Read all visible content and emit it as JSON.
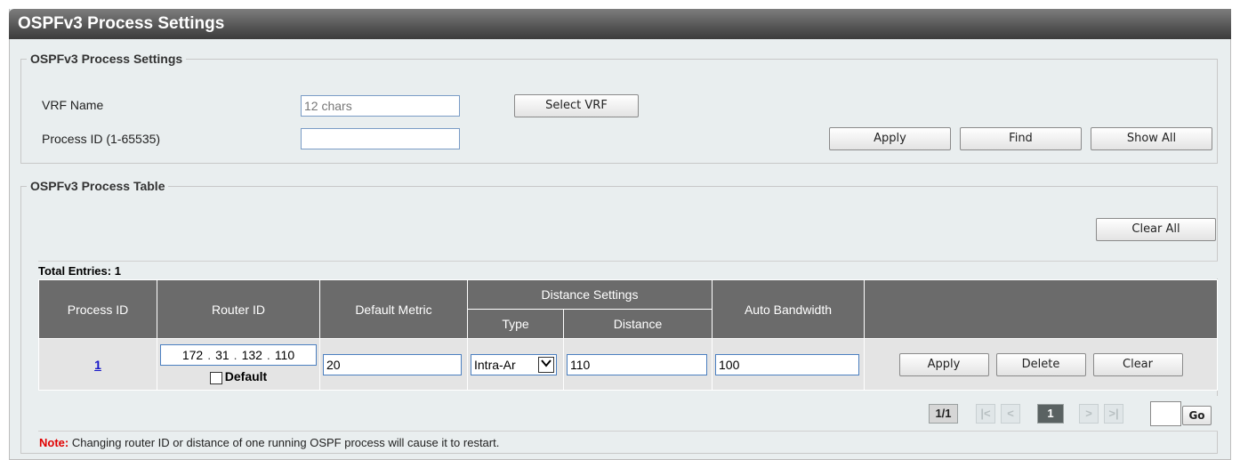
{
  "page": {
    "title": "OSPFv3 Process Settings"
  },
  "settings": {
    "legend": "OSPFv3 Process Settings",
    "vrf_label": "VRF Name",
    "vrf_placeholder": "12 chars",
    "vrf_value": "",
    "select_vrf_label": "Select VRF",
    "process_id_label": "Process ID (1-65535)",
    "process_id_value": "",
    "apply_label": "Apply",
    "find_label": "Find",
    "show_all_label": "Show All"
  },
  "table_section": {
    "legend": "OSPFv3 Process Table",
    "clear_all_label": "Clear All",
    "total_entries": "Total Entries: 1",
    "headers": {
      "process_id": "Process ID",
      "router_id": "Router ID",
      "default_metric": "Default Metric",
      "distance_settings": "Distance Settings",
      "type": "Type",
      "distance": "Distance",
      "auto_bandwidth": "Auto Bandwidth"
    },
    "rows": [
      {
        "process_id": "1",
        "router_id": [
          "172",
          "31",
          "132",
          "110"
        ],
        "default_label": "Default",
        "default_checked": false,
        "default_metric": "20",
        "type": "Intra-Ar",
        "distance": "110",
        "auto_bandwidth": "100",
        "apply_label": "Apply",
        "delete_label": "Delete",
        "clear_label": "Clear"
      }
    ]
  },
  "pager": {
    "page_info": "1/1",
    "first": "|<",
    "prev": "<",
    "current": "1",
    "next": ">",
    "last": ">|",
    "go_label": "Go",
    "go_value": ""
  },
  "note": {
    "prefix": "Note:",
    "text": " Changing router ID or distance of one running OSPF process will cause it to restart."
  }
}
